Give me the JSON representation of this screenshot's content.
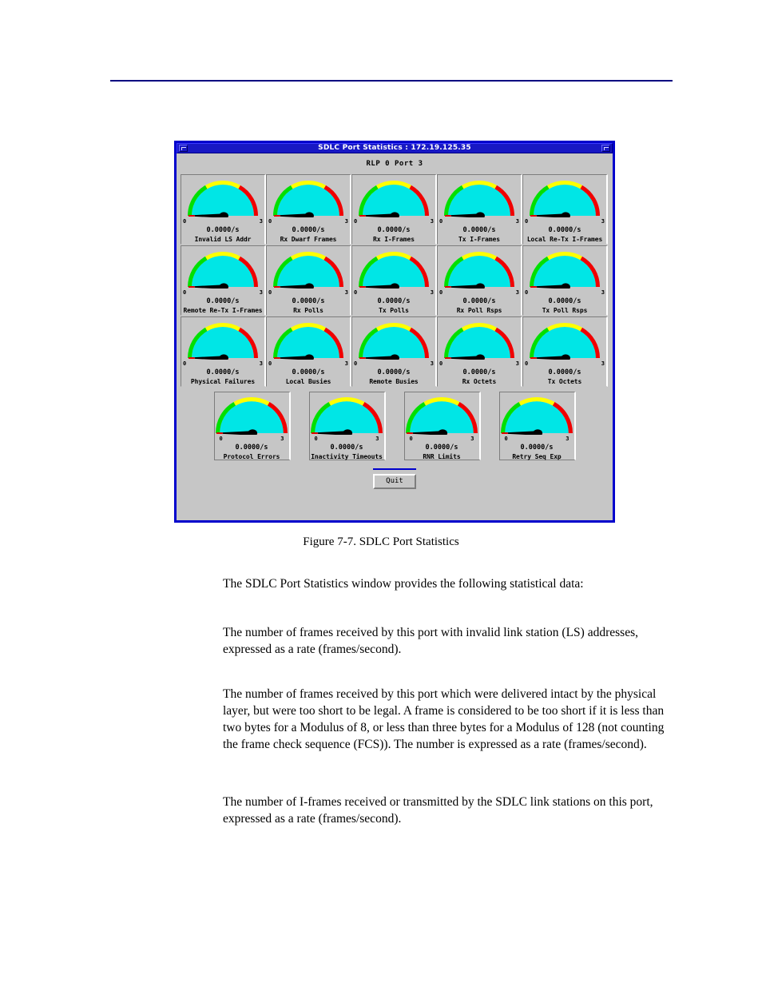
{
  "page": {
    "rule_color": "#000080",
    "figure_caption": "Figure 7-7.  SDLC Port Statistics",
    "paragraphs": [
      "The SDLC Port Statistics window provides the following statistical data:",
      "The number of frames received by this port with invalid link station (LS) addresses, expressed as a rate (frames/second).",
      "The number of frames received by this port which were delivered intact by the physical layer, but were too short to be legal. A frame is considered to be too short if it is less than two bytes for a Modulus of 8, or less than three bytes for a Modulus of 128 (not counting the frame check sequence (FCS)). The number is expressed as a rate (frames/second).",
      "The number of I-frames received or transmitted by the SDLC link stations on this port, expressed as a rate (frames/second)."
    ]
  },
  "window": {
    "title": "SDLC Port Statistics : 172.19.125.35",
    "title_bg": "#1818c4",
    "frame_color": "#0000cc",
    "body_bg": "#c6c6c6",
    "subtitle": "RLP 0 Port 3",
    "menu_icon": "window-menu-icon",
    "resize_icon": "window-resize-icon",
    "quit_label": "Quit"
  },
  "gauge_defaults": {
    "tick_low": "0",
    "tick_high": "3",
    "value": "0.0000/s",
    "face_color": "#00e6e6",
    "green": "#00e000",
    "yellow": "#ffff00",
    "red": "#f00000",
    "needle_color": "#000000",
    "needle_tip_color": "#e00000",
    "min": 0,
    "max": 3,
    "current": 0
  },
  "chart_data": {
    "type": "gauge-panel",
    "title": "SDLC Port Statistics : 172.19.125.35",
    "subtitle": "RLP 0 Port 3",
    "axis_min": 0,
    "axis_max": 3,
    "unit": "/s",
    "bands": [
      {
        "name": "green",
        "from": 0,
        "to": 1,
        "color": "#00e000"
      },
      {
        "name": "yellow",
        "from": 1,
        "to": 2,
        "color": "#ffff00"
      },
      {
        "name": "red",
        "from": 2,
        "to": 3,
        "color": "#f00000"
      }
    ],
    "gauges": [
      {
        "label": "Invalid LS Addr",
        "value": 0,
        "display": "0.0000/s"
      },
      {
        "label": "Rx Dwarf Frames",
        "value": 0,
        "display": "0.0000/s"
      },
      {
        "label": "Rx I-Frames",
        "value": 0,
        "display": "0.0000/s"
      },
      {
        "label": "Tx I-Frames",
        "value": 0,
        "display": "0.0000/s"
      },
      {
        "label": "Local Re-Tx I-Frames",
        "value": 0,
        "display": "0.0000/s"
      },
      {
        "label": "Remote Re-Tx I-Frames",
        "value": 0,
        "display": "0.0000/s"
      },
      {
        "label": "Rx Polls",
        "value": 0,
        "display": "0.0000/s"
      },
      {
        "label": "Tx Polls",
        "value": 0,
        "display": "0.0000/s"
      },
      {
        "label": "Rx Poll Rsps",
        "value": 0,
        "display": "0.0000/s"
      },
      {
        "label": "Tx Poll Rsps",
        "value": 0,
        "display": "0.0000/s"
      },
      {
        "label": "Physical Failures",
        "value": 0,
        "display": "0.0000/s"
      },
      {
        "label": "Local Busies",
        "value": 0,
        "display": "0.0000/s"
      },
      {
        "label": "Remote Busies",
        "value": 0,
        "display": "0.0000/s"
      },
      {
        "label": "Rx Octets",
        "value": 0,
        "display": "0.0000/s"
      },
      {
        "label": "Tx Octets",
        "value": 0,
        "display": "0.0000/s"
      },
      {
        "label": "Protocol Errors",
        "value": 0,
        "display": "0.0000/s"
      },
      {
        "label": "Inactivity Timeouts",
        "value": 0,
        "display": "0.0000/s"
      },
      {
        "label": "RNR Limits",
        "value": 0,
        "display": "0.0000/s"
      },
      {
        "label": "Retry Seq Exp",
        "value": 0,
        "display": "0.0000/s"
      }
    ]
  }
}
